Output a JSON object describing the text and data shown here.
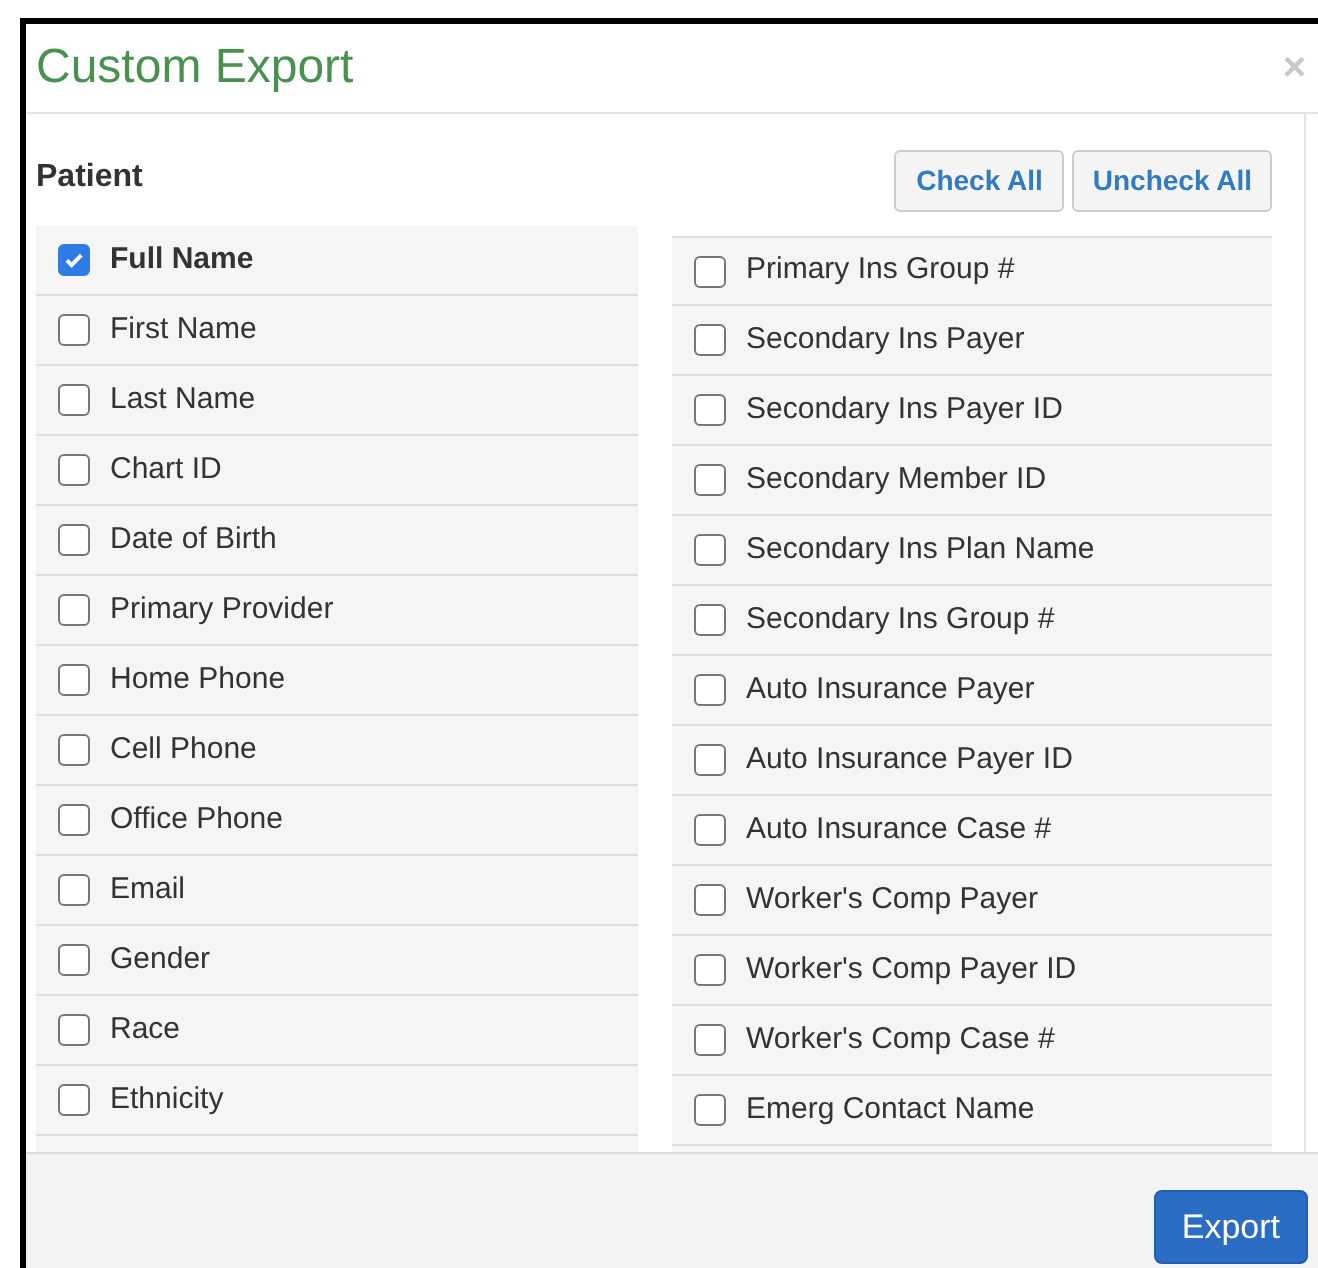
{
  "dialog": {
    "title": "Custom Export",
    "close": "×"
  },
  "section": {
    "title": "Patient"
  },
  "buttons": {
    "check_all": "Check All",
    "uncheck_all": "Uncheck All",
    "export": "Export"
  },
  "left_fields": [
    {
      "label": "Full Name",
      "checked": true
    },
    {
      "label": "First Name",
      "checked": false
    },
    {
      "label": "Last Name",
      "checked": false
    },
    {
      "label": "Chart ID",
      "checked": false
    },
    {
      "label": "Date of Birth",
      "checked": false
    },
    {
      "label": "Primary Provider",
      "checked": false
    },
    {
      "label": "Home Phone",
      "checked": false
    },
    {
      "label": "Cell Phone",
      "checked": false
    },
    {
      "label": "Office Phone",
      "checked": false
    },
    {
      "label": "Email",
      "checked": false
    },
    {
      "label": "Gender",
      "checked": false
    },
    {
      "label": "Race",
      "checked": false
    },
    {
      "label": "Ethnicity",
      "checked": false
    }
  ],
  "right_fields": [
    {
      "label": "Primary Ins Group #",
      "checked": false
    },
    {
      "label": "Secondary Ins Payer",
      "checked": false
    },
    {
      "label": "Secondary Ins Payer ID",
      "checked": false
    },
    {
      "label": "Secondary Member ID",
      "checked": false
    },
    {
      "label": "Secondary Ins Plan Name",
      "checked": false
    },
    {
      "label": "Secondary Ins Group #",
      "checked": false
    },
    {
      "label": "Auto Insurance Payer",
      "checked": false
    },
    {
      "label": "Auto Insurance Payer ID",
      "checked": false
    },
    {
      "label": "Auto Insurance Case #",
      "checked": false
    },
    {
      "label": "Worker's Comp Payer",
      "checked": false
    },
    {
      "label": "Worker's Comp Payer ID",
      "checked": false
    },
    {
      "label": "Worker's Comp Case #",
      "checked": false
    },
    {
      "label": "Emerg Contact Name",
      "checked": false
    }
  ]
}
